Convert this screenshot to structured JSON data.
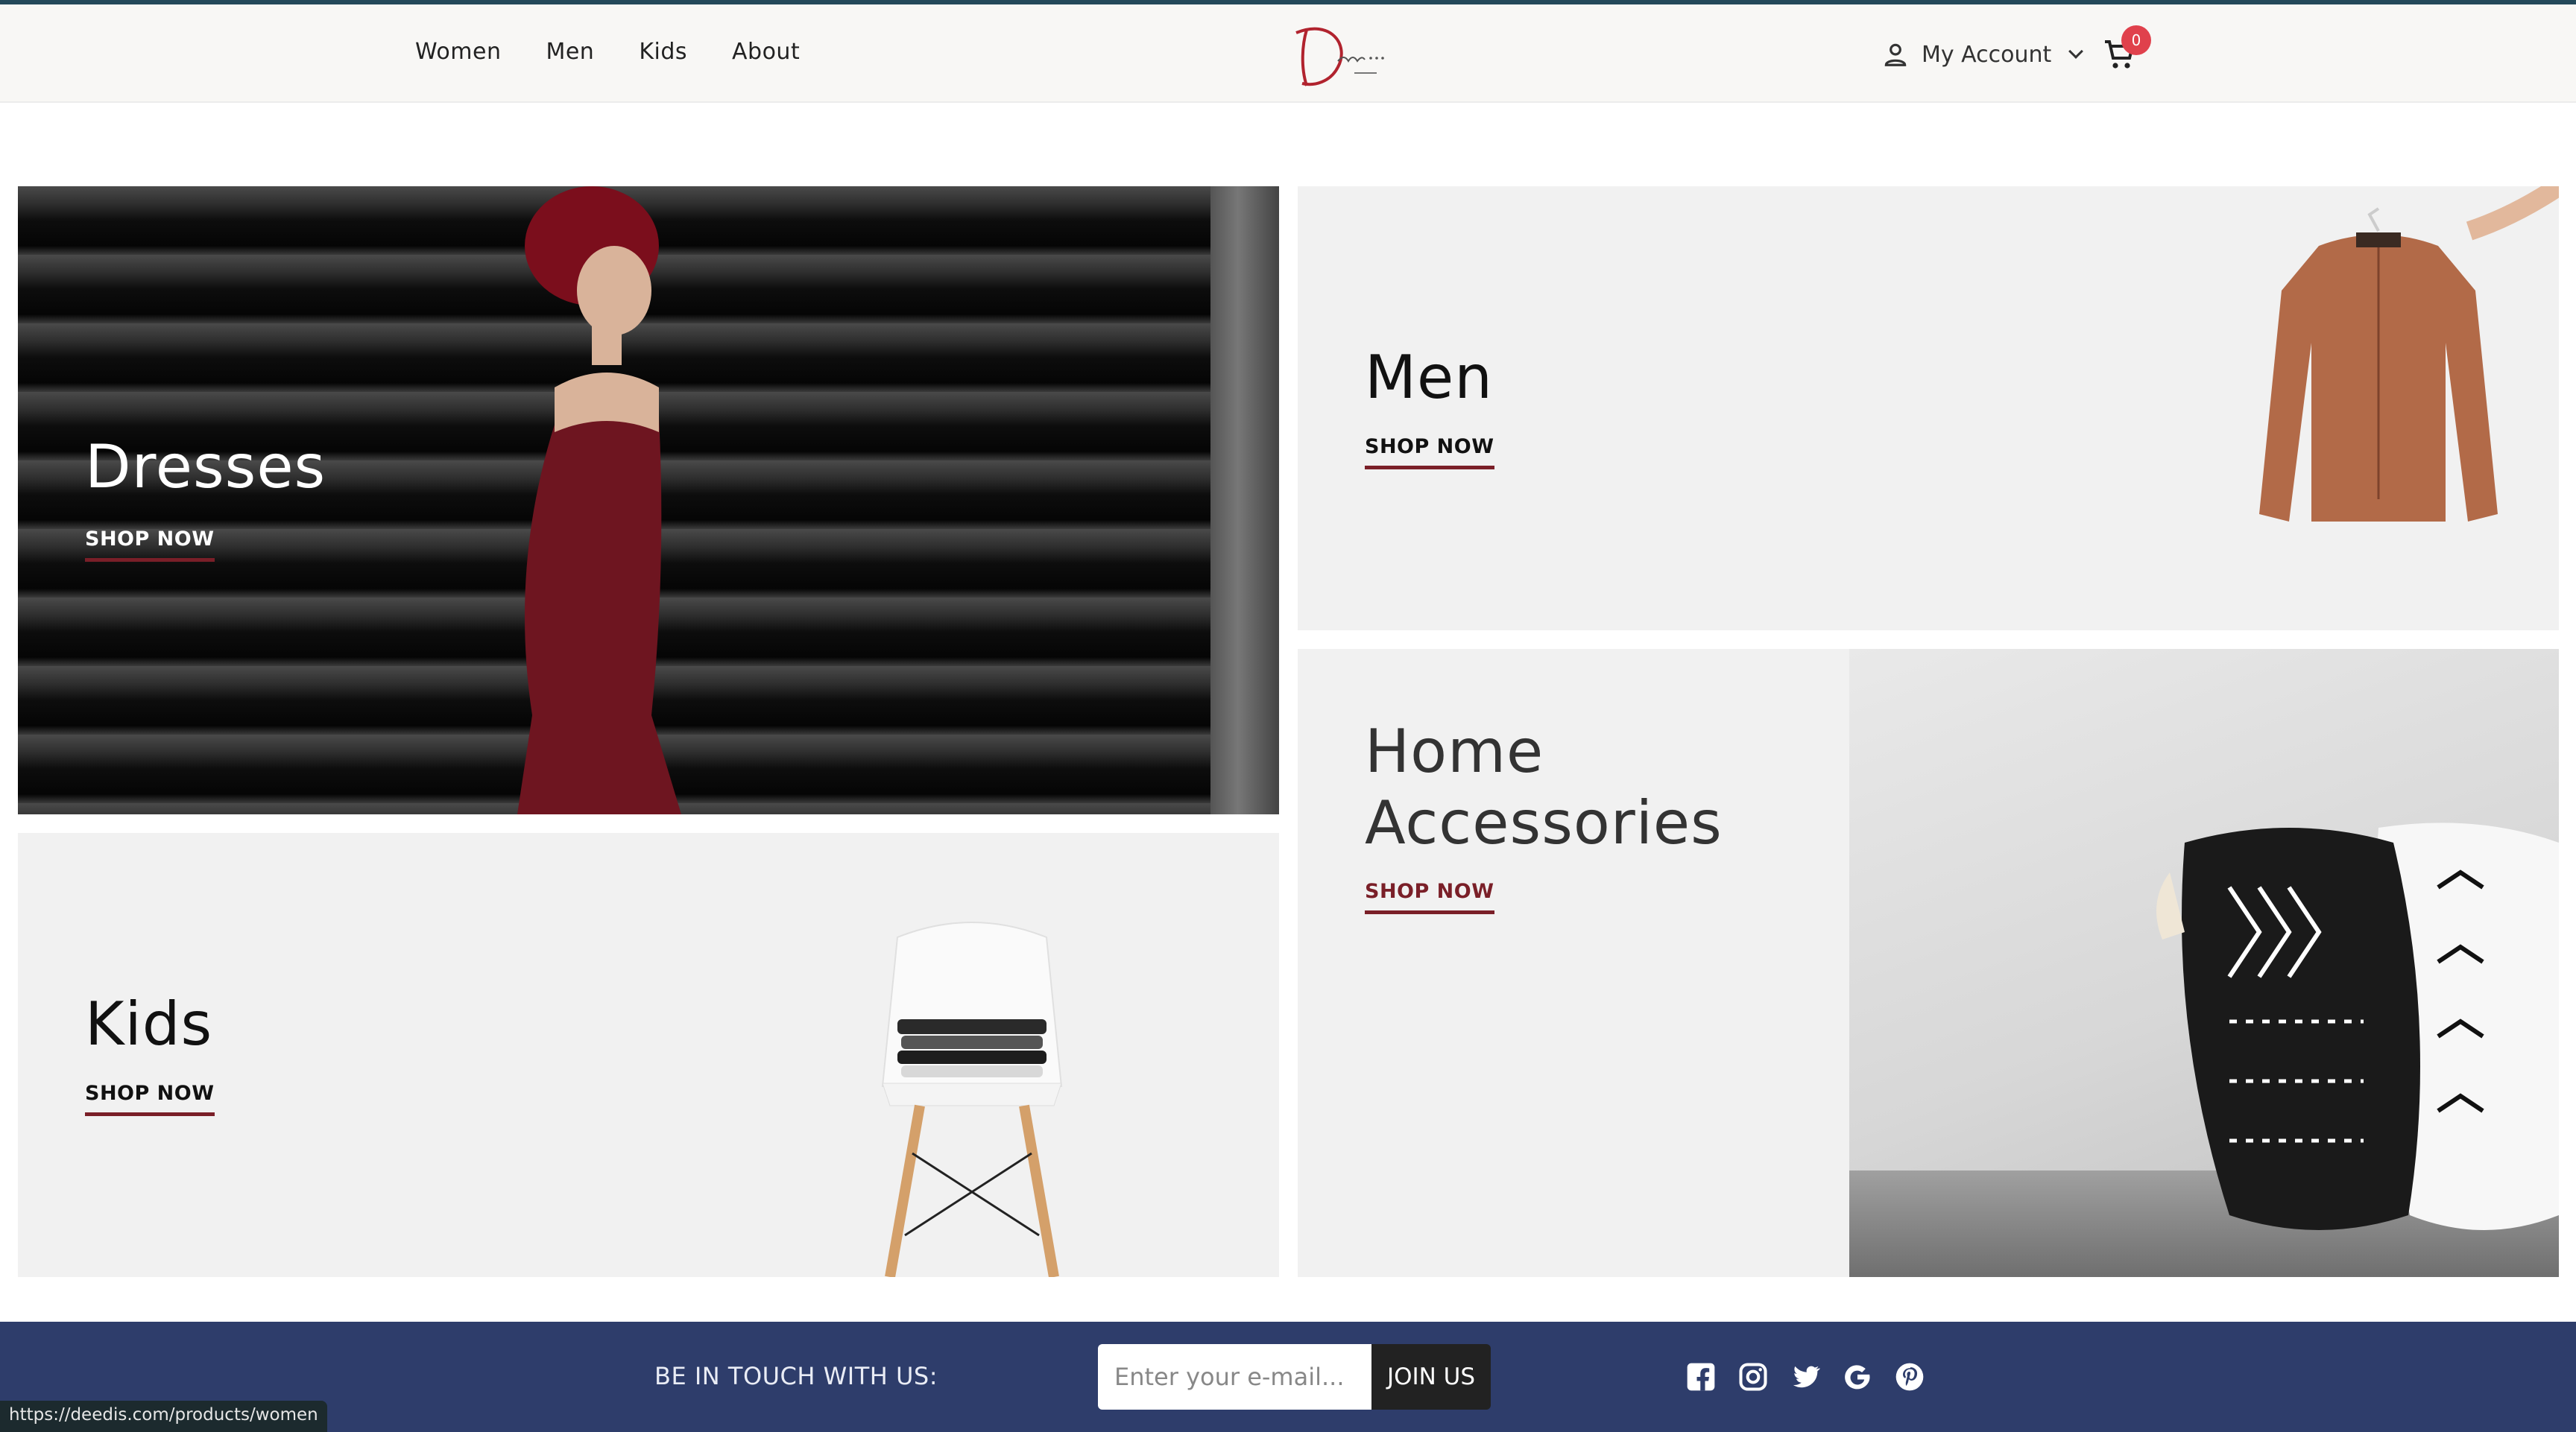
{
  "nav": {
    "items": [
      {
        "label": "Women"
      },
      {
        "label": "Men"
      },
      {
        "label": "Kids"
      },
      {
        "label": "About"
      }
    ]
  },
  "logo": {
    "alt": "Deedis logo"
  },
  "account": {
    "label": "My Account"
  },
  "cart": {
    "count": "0"
  },
  "tiles": {
    "dresses": {
      "title": "Dresses",
      "cta": "SHOP NOW"
    },
    "men": {
      "title": "Men",
      "cta": "SHOP NOW"
    },
    "kids": {
      "title": "Kids",
      "cta": "SHOP NOW"
    },
    "home": {
      "title_line1": "Home",
      "title_line2": "Accessories",
      "cta": "SHOP NOW"
    }
  },
  "footer": {
    "touch_label": "BE IN TOUCH WITH US:",
    "email_placeholder": "Enter your e-mail...",
    "join_label": "JOIN US",
    "social": [
      "facebook-icon",
      "instagram-icon",
      "twitter-icon",
      "google-icon",
      "pinterest-icon"
    ]
  },
  "status": {
    "url": "https://deedis.com/products/women"
  },
  "colors": {
    "accent": "#7a1f28",
    "footer_bg": "#2e3d6b",
    "badge": "#e0414c",
    "topline": "#24495a"
  }
}
